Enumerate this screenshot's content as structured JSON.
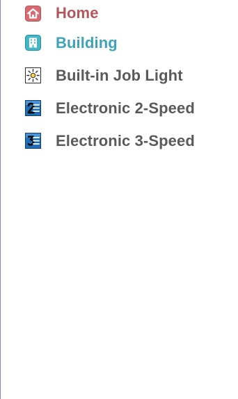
{
  "nav": {
    "items": [
      {
        "label": "Home",
        "icon": "home-icon",
        "color": "#b3565b"
      },
      {
        "label": "Building",
        "icon": "building-icon",
        "color": "#3ea3b8"
      },
      {
        "label": "Built-in Job Light",
        "icon": "job-light-icon",
        "color": "#5a5a5a"
      },
      {
        "label": "Electronic 2-Speed",
        "icon": "two-speed-icon",
        "color": "#5a5a5a"
      },
      {
        "label": "Electronic 3-Speed",
        "icon": "three-speed-icon",
        "color": "#5a5a5a"
      }
    ]
  }
}
